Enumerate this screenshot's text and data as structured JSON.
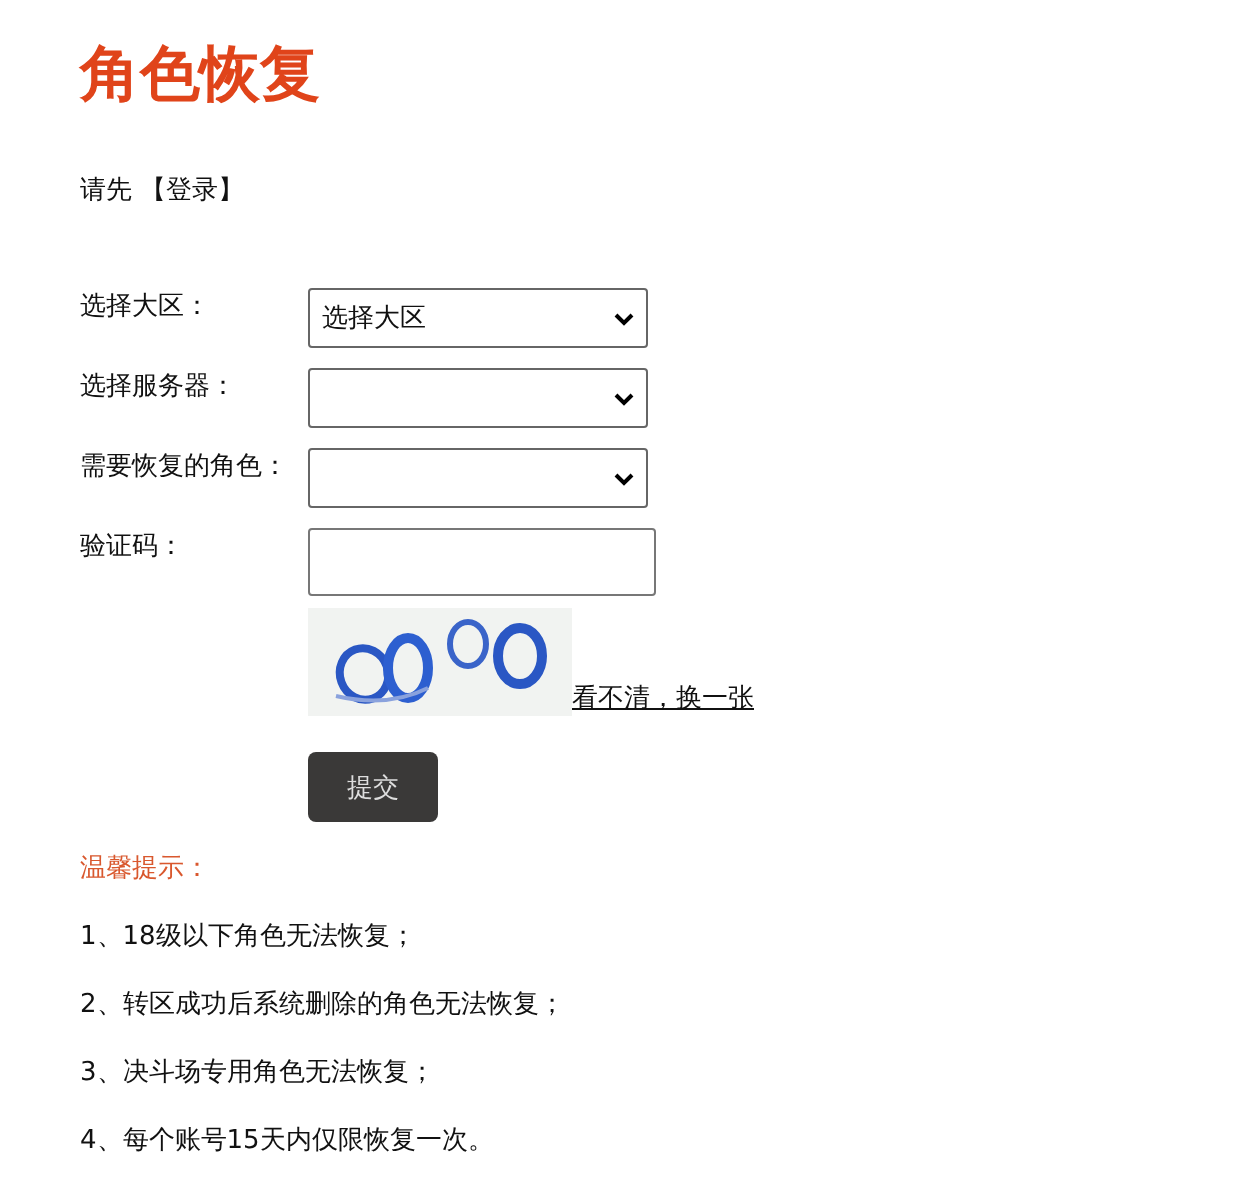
{
  "title": "角色恢复",
  "login_prompt": {
    "text": "请先",
    "link": "【登录】"
  },
  "form": {
    "fields": [
      {
        "label": "选择大区：",
        "kind": "select",
        "value": "选择大区"
      },
      {
        "label": "选择服务器：",
        "kind": "select"
      },
      {
        "label": "需要恢复的角色：",
        "kind": "select"
      },
      {
        "label": "验证码：",
        "kind": "input"
      }
    ],
    "captcha": {
      "kind": "picture",
      "refresh_link": "看不清，换一张"
    },
    "submit": "提交"
  },
  "tips": {
    "heading": "温馨提示：",
    "items": [
      "1、18级以下角色无法恢复；",
      "2、转区成功后系统删除的角色无法恢复；",
      "3、决斗场专用角色无法恢复；",
      "4、每个账号15天内仅限恢复一次。"
    ]
  }
}
